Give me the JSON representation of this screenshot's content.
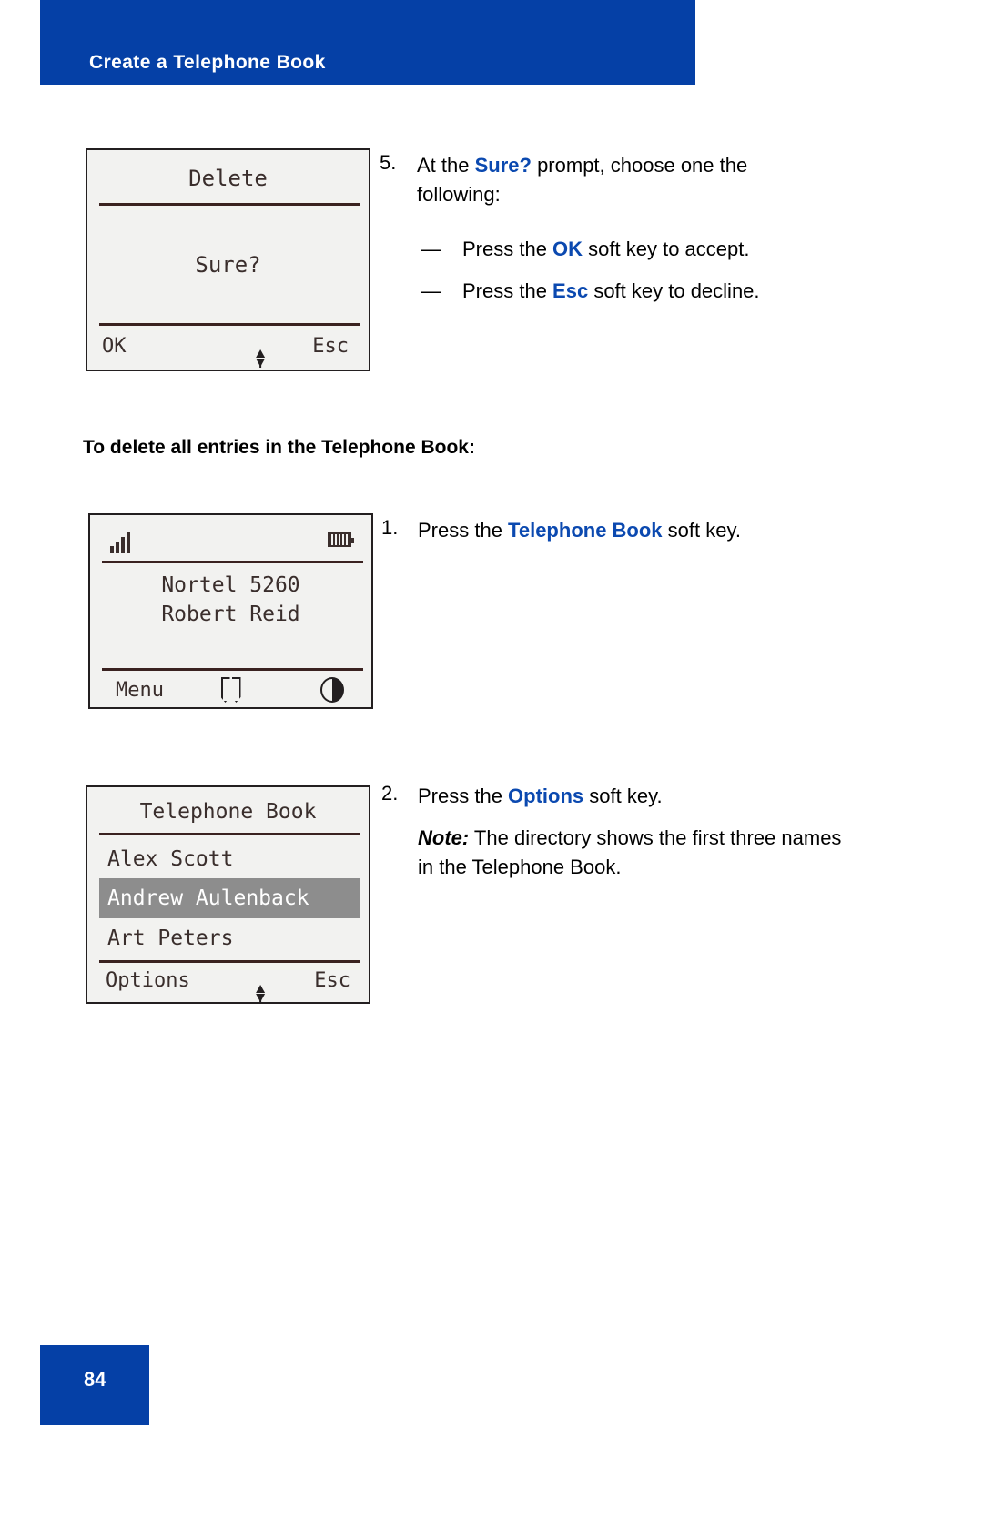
{
  "header": {
    "title": "Create a Telephone Book",
    "bg_color": "#0540a6"
  },
  "screens": {
    "delete_confirm": {
      "title": "Delete",
      "prompt": "Sure?",
      "softkey_left": "OK",
      "softkey_right": "Esc",
      "softkey_middle_icon": "up-down-arrow-icon"
    },
    "idle": {
      "signal_icon": "signal-bars-icon",
      "battery_icon": "battery-icon",
      "line1": "Nortel 5260",
      "line2": "Robert Reid",
      "softkey_left": "Menu",
      "softkey_middle_icon": "directory-book-icon",
      "softkey_right_icon": "contrast-icon"
    },
    "telephone_book": {
      "title": "Telephone Book",
      "entries": [
        {
          "name": "Alex Scott",
          "selected": false
        },
        {
          "name": "Andrew Aulenback",
          "selected": true
        },
        {
          "name": "Art Peters",
          "selected": false
        }
      ],
      "softkey_left": "Options",
      "softkey_right": "Esc",
      "softkey_middle_icon": "up-down-arrow-icon"
    }
  },
  "steps": {
    "step5": {
      "number": "5.",
      "text_before": "At the ",
      "keyword": "Sure?",
      "text_after": " prompt, choose one the",
      "line2": "following:",
      "bullets": [
        {
          "mark": "—",
          "before": "Press the ",
          "keyword": "OK",
          "after": " soft key to accept."
        },
        {
          "mark": "—",
          "before": "Press the ",
          "keyword": "Esc",
          "after": " soft key to decline."
        }
      ]
    },
    "section_heading": "To delete all entries in the Telephone Book:",
    "step1": {
      "number": "1.",
      "before": "Press the ",
      "keyword": "Telephone Book",
      "after": " soft key."
    },
    "step2": {
      "number": "2.",
      "before": "Press the ",
      "keyword": "Options",
      "after": " soft key.",
      "note_label": "Note:",
      "note_text": " The directory shows the first three names in the Telephone Book."
    }
  },
  "footer": {
    "page_number": "84"
  },
  "colors": {
    "brand_blue": "#0540a6",
    "keyword_blue": "#0b49b0",
    "lcd_bg": "#f2f2f0",
    "lcd_text": "#3a2e2c",
    "highlight_gray": "#8d8d8d"
  }
}
